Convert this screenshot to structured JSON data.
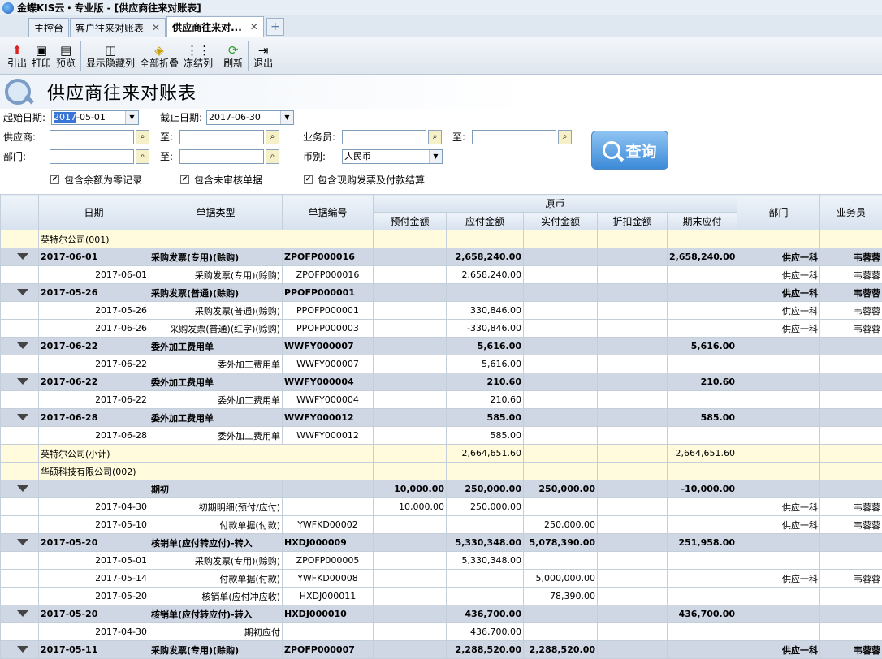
{
  "window_title": "金蝶KIS云・专业版 - [供应商往来对账表]",
  "tabs": [
    {
      "label": "主控台"
    },
    {
      "label": "客户往来对账表"
    },
    {
      "label": "供应商往来对..."
    }
  ],
  "toolbar": {
    "export": "引出",
    "print": "打印",
    "preview": "预览",
    "showhide": "显示隐藏列",
    "collapse": "全部折叠",
    "freeze": "冻结列",
    "refresh": "刷新",
    "exit": "退出"
  },
  "page_title": "供应商往来对账表",
  "filters": {
    "start_label": "起始日期:",
    "start_sel": "2017",
    "start_rest": "-05-01",
    "end_label": "截止日期:",
    "end_value": "2017-06-30",
    "supplier_label": "供应商:",
    "to_label": "至:",
    "dept_label": "部门:",
    "staff_label": "业务员:",
    "currency_label": "币别:",
    "currency_value": "人民币",
    "chk1": "包含余额为零记录",
    "chk2": "包含未审核单据",
    "chk3": "包含现购发票及付款结算",
    "query": "查询"
  },
  "table": {
    "headers": {
      "date": "日期",
      "type": "单据类型",
      "no": "单据编号",
      "orig": "原币",
      "prepay": "预付金额",
      "payable": "应付金额",
      "paid": "实付金额",
      "discount": "折扣金额",
      "ending": "期末应付",
      "dept": "部门",
      "staff": "业务员"
    },
    "rows": [
      {
        "k": "grp",
        "name": "英特尔公司(001)"
      },
      {
        "k": "sub",
        "date": "2017-06-01",
        "type": "采购发票(专用)(赊购)",
        "no": "ZPOFP000016",
        "prepay": "",
        "payable": "2,658,240.00",
        "paid": "",
        "discount": "",
        "ending": "2,658,240.00",
        "dept": "供应一科",
        "staff": "韦蓉蓉"
      },
      {
        "k": "det",
        "date": "2017-06-01",
        "type": "采购发票(专用)(赊购)",
        "no": "ZPOFP000016",
        "prepay": "",
        "payable": "2,658,240.00",
        "paid": "",
        "discount": "",
        "ending": "",
        "dept": "供应一科",
        "staff": "韦蓉蓉"
      },
      {
        "k": "sub",
        "date": "2017-05-26",
        "type": "采购发票(普通)(赊购)",
        "no": "PPOFP000001",
        "prepay": "",
        "payable": "",
        "paid": "",
        "discount": "",
        "ending": "",
        "dept": "供应一科",
        "staff": "韦蓉蓉"
      },
      {
        "k": "det",
        "date": "2017-05-26",
        "type": "采购发票(普通)(赊购)",
        "no": "PPOFP000001",
        "prepay": "",
        "payable": "330,846.00",
        "paid": "",
        "discount": "",
        "ending": "",
        "dept": "供应一科",
        "staff": "韦蓉蓉"
      },
      {
        "k": "det",
        "date": "2017-06-26",
        "type": "采购发票(普通)(红字)(赊购)",
        "no": "PPOFP000003",
        "prepay": "",
        "payable": "-330,846.00",
        "paid": "",
        "discount": "",
        "ending": "",
        "dept": "供应一科",
        "staff": "韦蓉蓉"
      },
      {
        "k": "sub",
        "date": "2017-06-22",
        "type": "委外加工费用单",
        "no": "WWFY000007",
        "prepay": "",
        "payable": "5,616.00",
        "paid": "",
        "discount": "",
        "ending": "5,616.00",
        "dept": "",
        "staff": ""
      },
      {
        "k": "det",
        "date": "2017-06-22",
        "type": "委外加工费用单",
        "no": "WWFY000007",
        "prepay": "",
        "payable": "5,616.00",
        "paid": "",
        "discount": "",
        "ending": "",
        "dept": "",
        "staff": ""
      },
      {
        "k": "sub",
        "date": "2017-06-22",
        "type": "委外加工费用单",
        "no": "WWFY000004",
        "prepay": "",
        "payable": "210.60",
        "paid": "",
        "discount": "",
        "ending": "210.60",
        "dept": "",
        "staff": ""
      },
      {
        "k": "det",
        "date": "2017-06-22",
        "type": "委外加工费用单",
        "no": "WWFY000004",
        "prepay": "",
        "payable": "210.60",
        "paid": "",
        "discount": "",
        "ending": "",
        "dept": "",
        "staff": ""
      },
      {
        "k": "sub",
        "date": "2017-06-28",
        "type": "委外加工费用单",
        "no": "WWFY000012",
        "prepay": "",
        "payable": "585.00",
        "paid": "",
        "discount": "",
        "ending": "585.00",
        "dept": "",
        "staff": ""
      },
      {
        "k": "det",
        "date": "2017-06-28",
        "type": "委外加工费用单",
        "no": "WWFY000012",
        "prepay": "",
        "payable": "585.00",
        "paid": "",
        "discount": "",
        "ending": "",
        "dept": "",
        "staff": ""
      },
      {
        "k": "tot",
        "name": "英特尔公司(小计)",
        "payable": "2,664,651.60",
        "ending": "2,664,651.60"
      },
      {
        "k": "grp",
        "name": "华硕科技有限公司(002)"
      },
      {
        "k": "sub",
        "date": "",
        "type": "期初",
        "no": "",
        "prepay": "10,000.00",
        "payable": "250,000.00",
        "paid": "250,000.00",
        "discount": "",
        "ending": "-10,000.00",
        "dept": "",
        "staff": ""
      },
      {
        "k": "det",
        "date": "2017-04-30",
        "type": "初期明细(预付/应付)",
        "no": "",
        "prepay": "10,000.00",
        "payable": "250,000.00",
        "paid": "",
        "discount": "",
        "ending": "",
        "dept": "供应一科",
        "staff": "韦蓉蓉"
      },
      {
        "k": "det",
        "date": "2017-05-10",
        "type": "付款单据(付款)",
        "no": "YWFKD00002",
        "prepay": "",
        "payable": "",
        "paid": "250,000.00",
        "discount": "",
        "ending": "",
        "dept": "供应一科",
        "staff": "韦蓉蓉"
      },
      {
        "k": "sub",
        "date": "2017-05-20",
        "type": "核销单(应付转应付)-转入",
        "no": "HXDJ000009",
        "prepay": "",
        "payable": "5,330,348.00",
        "paid": "5,078,390.00",
        "discount": "",
        "ending": "251,958.00",
        "dept": "",
        "staff": ""
      },
      {
        "k": "det",
        "date": "2017-05-01",
        "type": "采购发票(专用)(赊购)",
        "no": "ZPOFP000005",
        "prepay": "",
        "payable": "5,330,348.00",
        "paid": "",
        "discount": "",
        "ending": "",
        "dept": "",
        "staff": ""
      },
      {
        "k": "det",
        "date": "2017-05-14",
        "type": "付款单据(付款)",
        "no": "YWFKD00008",
        "prepay": "",
        "payable": "",
        "paid": "5,000,000.00",
        "discount": "",
        "ending": "",
        "dept": "供应一科",
        "staff": "韦蓉蓉"
      },
      {
        "k": "det",
        "date": "2017-05-20",
        "type": "核销单(应付冲应收)",
        "no": "HXDJ000011",
        "prepay": "",
        "payable": "",
        "paid": "78,390.00",
        "discount": "",
        "ending": "",
        "dept": "",
        "staff": ""
      },
      {
        "k": "sub",
        "date": "2017-05-20",
        "type": "核销单(应付转应付)-转入",
        "no": "HXDJ000010",
        "prepay": "",
        "payable": "436,700.00",
        "paid": "",
        "discount": "",
        "ending": "436,700.00",
        "dept": "",
        "staff": ""
      },
      {
        "k": "det",
        "date": "2017-04-30",
        "type": "期初应付",
        "no": "",
        "prepay": "",
        "payable": "436,700.00",
        "paid": "",
        "discount": "",
        "ending": "",
        "dept": "",
        "staff": ""
      },
      {
        "k": "sub",
        "date": "2017-05-11",
        "type": "采购发票(专用)(赊购)",
        "no": "ZPOFP000007",
        "prepay": "",
        "payable": "2,288,520.00",
        "paid": "2,288,520.00",
        "discount": "",
        "ending": "",
        "dept": "供应一科",
        "staff": "韦蓉蓉"
      }
    ]
  }
}
